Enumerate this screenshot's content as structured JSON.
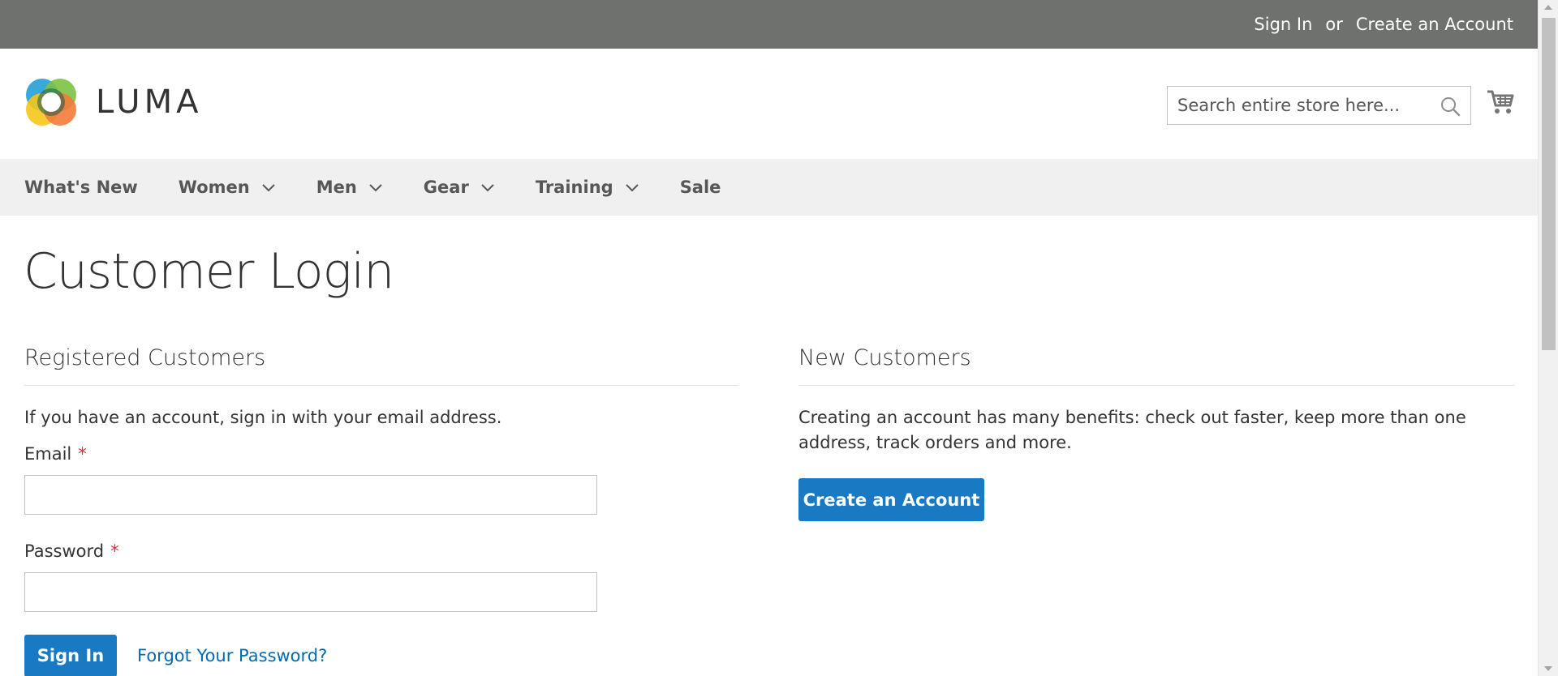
{
  "top_panel": {
    "sign_in": "Sign In",
    "or": "or",
    "create_account": "Create an Account"
  },
  "header": {
    "logo_text": "LUMA",
    "search_placeholder": "Search entire store here...",
    "icons": [
      "luma-logo-icon",
      "search-icon",
      "cart-icon"
    ]
  },
  "nav": {
    "items": [
      {
        "label": "What's New",
        "has_dropdown": false
      },
      {
        "label": "Women",
        "has_dropdown": true
      },
      {
        "label": "Men",
        "has_dropdown": true
      },
      {
        "label": "Gear",
        "has_dropdown": true
      },
      {
        "label": "Training",
        "has_dropdown": true
      },
      {
        "label": "Sale",
        "has_dropdown": false
      }
    ]
  },
  "main": {
    "page_title": "Customer Login",
    "registered": {
      "title": "Registered Customers",
      "intro": "If you have an account, sign in with your email address.",
      "email_label": "Email",
      "password_label": "Password",
      "required_mark": "*",
      "sign_in_button": "Sign In",
      "forgot_link": "Forgot Your Password?"
    },
    "new_customers": {
      "title": "New Customers",
      "text": "Creating an account has many benefits: check out faster, keep more than one address, track orders and more.",
      "create_button": "Create an Account"
    }
  },
  "colors": {
    "top_panel_bg": "#6e716e",
    "nav_bg": "#f0f0f0",
    "primary_button": "#1979c3",
    "link": "#006bb4",
    "required": "#e02b27"
  }
}
